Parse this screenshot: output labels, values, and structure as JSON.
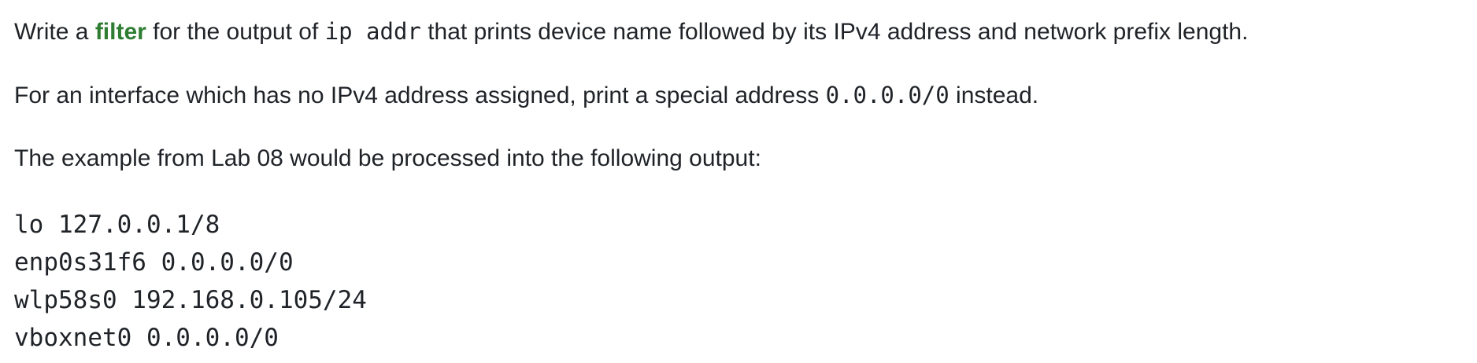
{
  "paragraph1": {
    "before_link": "Write a ",
    "link_text": "filter",
    "after_link": " for the output of ",
    "code": "ip addr",
    "after_code": " that prints device name followed by its IPv4 address and network prefix length."
  },
  "paragraph2": {
    "before_code": "For an interface which has no IPv4 address assigned, print a special address ",
    "code": "0.0.0.0/0",
    "after_code": " instead."
  },
  "paragraph3": {
    "text": "The example from Lab 08 would be processed into the following output:"
  },
  "output_lines": [
    "lo 127.0.0.1/8",
    "enp0s31f6 0.0.0.0/0",
    "wlp58s0 192.168.0.105/24",
    "vboxnet0 0.0.0.0/0"
  ],
  "colors": {
    "link": "#2e7d32",
    "text": "#1f2328"
  }
}
